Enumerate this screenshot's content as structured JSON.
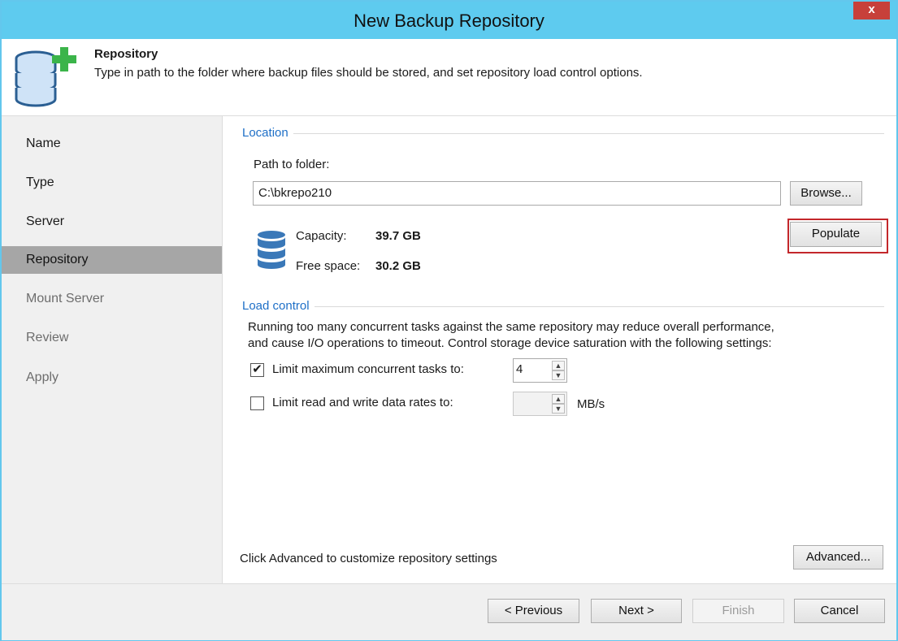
{
  "window": {
    "title": "New Backup Repository",
    "close_glyph": "x"
  },
  "header": {
    "title": "Repository",
    "description": "Type in path to the folder where backup files should be stored, and set repository load control options.",
    "icon": "database-add-icon"
  },
  "sidebar": {
    "items": [
      {
        "label": "Name",
        "state": "normal"
      },
      {
        "label": "Type",
        "state": "normal"
      },
      {
        "label": "Server",
        "state": "normal"
      },
      {
        "label": "Repository",
        "state": "active"
      },
      {
        "label": "Mount Server",
        "state": "disabled"
      },
      {
        "label": "Review",
        "state": "disabled"
      },
      {
        "label": "Apply",
        "state": "disabled"
      }
    ]
  },
  "location": {
    "group_title": "Location",
    "path_label": "Path to folder:",
    "path_value": "C:\\bkrepo210",
    "browse_label": "Browse...",
    "capacity_label": "Capacity:",
    "capacity_value": "39.7 GB",
    "free_label": "Free space:",
    "free_value": "30.2 GB",
    "populate_label": "Populate"
  },
  "load_control": {
    "group_title": "Load control",
    "description_line1": "Running too many concurrent tasks against the same repository may reduce overall performance,",
    "description_line2": "and cause I/O operations to timeout. Control storage device saturation with the following settings:",
    "limit_tasks_label": "Limit maximum concurrent tasks to:",
    "limit_tasks_checked": true,
    "limit_tasks_value": "4",
    "limit_rate_label": "Limit read and write data rates to:",
    "limit_rate_checked": false,
    "limit_rate_value": "",
    "rate_unit": "MB/s"
  },
  "advanced": {
    "hint": "Click Advanced to customize repository settings",
    "button_label": "Advanced..."
  },
  "footer": {
    "previous_label": "< Previous",
    "next_label": "Next >",
    "finish_label": "Finish",
    "cancel_label": "Cancel"
  },
  "colors": {
    "titlebar": "#5ecbef",
    "close": "#c7403a",
    "accent_link": "#1e6fc7",
    "highlight": "#c3272b",
    "active_nav": "#a6a6a6"
  }
}
